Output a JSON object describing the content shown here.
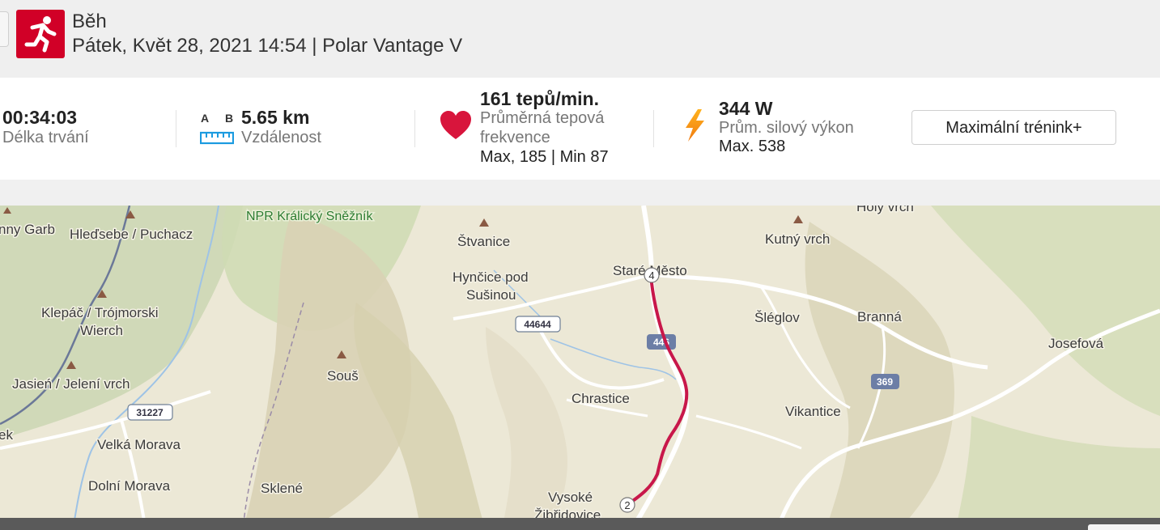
{
  "header": {
    "sport": "Běh",
    "session_info": "Pátek, Květ 28, 2021 14:54 | Polar Vantage V",
    "sport_icon": "running-icon",
    "accent_color": "#d10027"
  },
  "stats": {
    "duration": {
      "value": "00:34:03",
      "label": "Délka trvání"
    },
    "distance": {
      "value": "5.65 km",
      "label": "Vzdálenost",
      "a": "A",
      "b": "B",
      "icon": "ruler-icon"
    },
    "heart_rate": {
      "value": "161 tepů/min.",
      "label_line1": "Průměrná tepová",
      "label_line2": "frekvence",
      "minmax": "Max, 185  |  Min 87",
      "icon": "heart-icon"
    },
    "power": {
      "value": "344 W",
      "label": "Prům. silový výkon",
      "max": "Max. 538",
      "icon": "lightning-icon"
    },
    "button_label": "Maximální trénink+"
  },
  "map": {
    "places": [
      {
        "name": "nny Garb"
      },
      {
        "name": "Hleďsebe / Puchacz"
      },
      {
        "name": "NPR Králický Sněžník"
      },
      {
        "name": "Štvanice"
      },
      {
        "name": "Hynčice pod"
      },
      {
        "name": "Sušinou"
      },
      {
        "name": "Staré Město"
      },
      {
        "name": "Kutný vrch"
      },
      {
        "name": "Holý vrch"
      },
      {
        "name": "Klepáč / Trójmorski"
      },
      {
        "name": "Wierch"
      },
      {
        "name": "Šléglov"
      },
      {
        "name": "Branná"
      },
      {
        "name": "Josefová"
      },
      {
        "name": "Souš"
      },
      {
        "name": "Jasień / Jelení vrch"
      },
      {
        "name": "Chrastice"
      },
      {
        "name": "Vikantice"
      },
      {
        "name": "ek"
      },
      {
        "name": "Velká Morava"
      },
      {
        "name": "Dolní Morava"
      },
      {
        "name": "Sklené"
      },
      {
        "name": "Vysoké"
      },
      {
        "name": "Žibřidovice"
      }
    ],
    "road_numbers": [
      "44644",
      "31227",
      "446",
      "369"
    ],
    "km_markers": [
      "4",
      "2"
    ],
    "route_color": "#c8174a"
  }
}
